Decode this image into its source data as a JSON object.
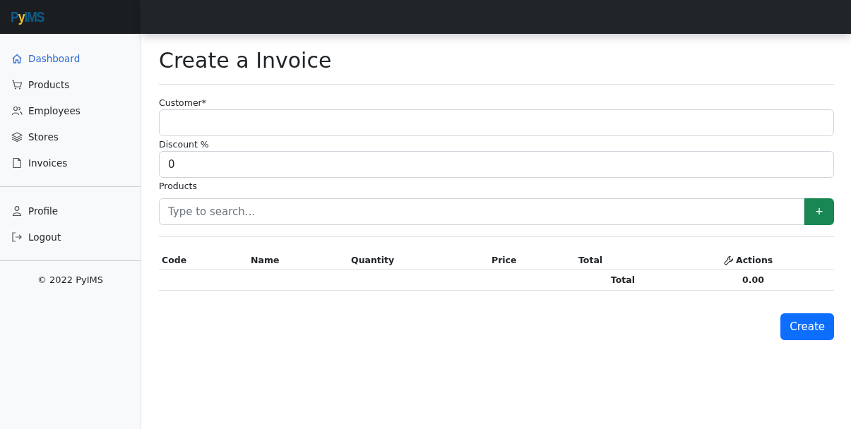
{
  "logo": [
    {
      "text": "P",
      "color": "#0d5c8a"
    },
    {
      "text": "y",
      "color": "#f2c12e"
    },
    {
      "text": "IMS",
      "color": "#0d5c8a"
    }
  ],
  "sidebar": {
    "items": [
      {
        "label": "Dashboard",
        "selected": true
      },
      {
        "label": "Products",
        "selected": false
      },
      {
        "label": "Employees",
        "selected": false
      },
      {
        "label": "Stores",
        "selected": false
      },
      {
        "label": "Invoices",
        "selected": false
      }
    ],
    "account_items": [
      {
        "label": "Profile",
        "selected": false
      },
      {
        "label": "Logout",
        "selected": false
      }
    ],
    "footer": "© 2022 PyIMS"
  },
  "page_title": "Create a Invoice",
  "form": {
    "fields": [
      {
        "label": "Customer*"
      },
      {
        "label": "Discount %",
        "value": "0"
      }
    ],
    "products_label": "Products",
    "search": {
      "placeholder": "Type to search...",
      "add_button": "+"
    }
  },
  "table": {
    "columns": [
      {
        "label": "Code",
        "kind": "plain"
      },
      {
        "label": "Name",
        "kind": "plain"
      },
      {
        "label": "Quantity",
        "kind": "plain"
      },
      {
        "label": "Price",
        "kind": "plain"
      },
      {
        "label": "Total",
        "kind": "plain"
      },
      {
        "label": "Actions",
        "kind": "tool"
      }
    ],
    "footer": {
      "label": "Total",
      "value": "0.00"
    }
  },
  "buttons": [
    "Create"
  ]
}
